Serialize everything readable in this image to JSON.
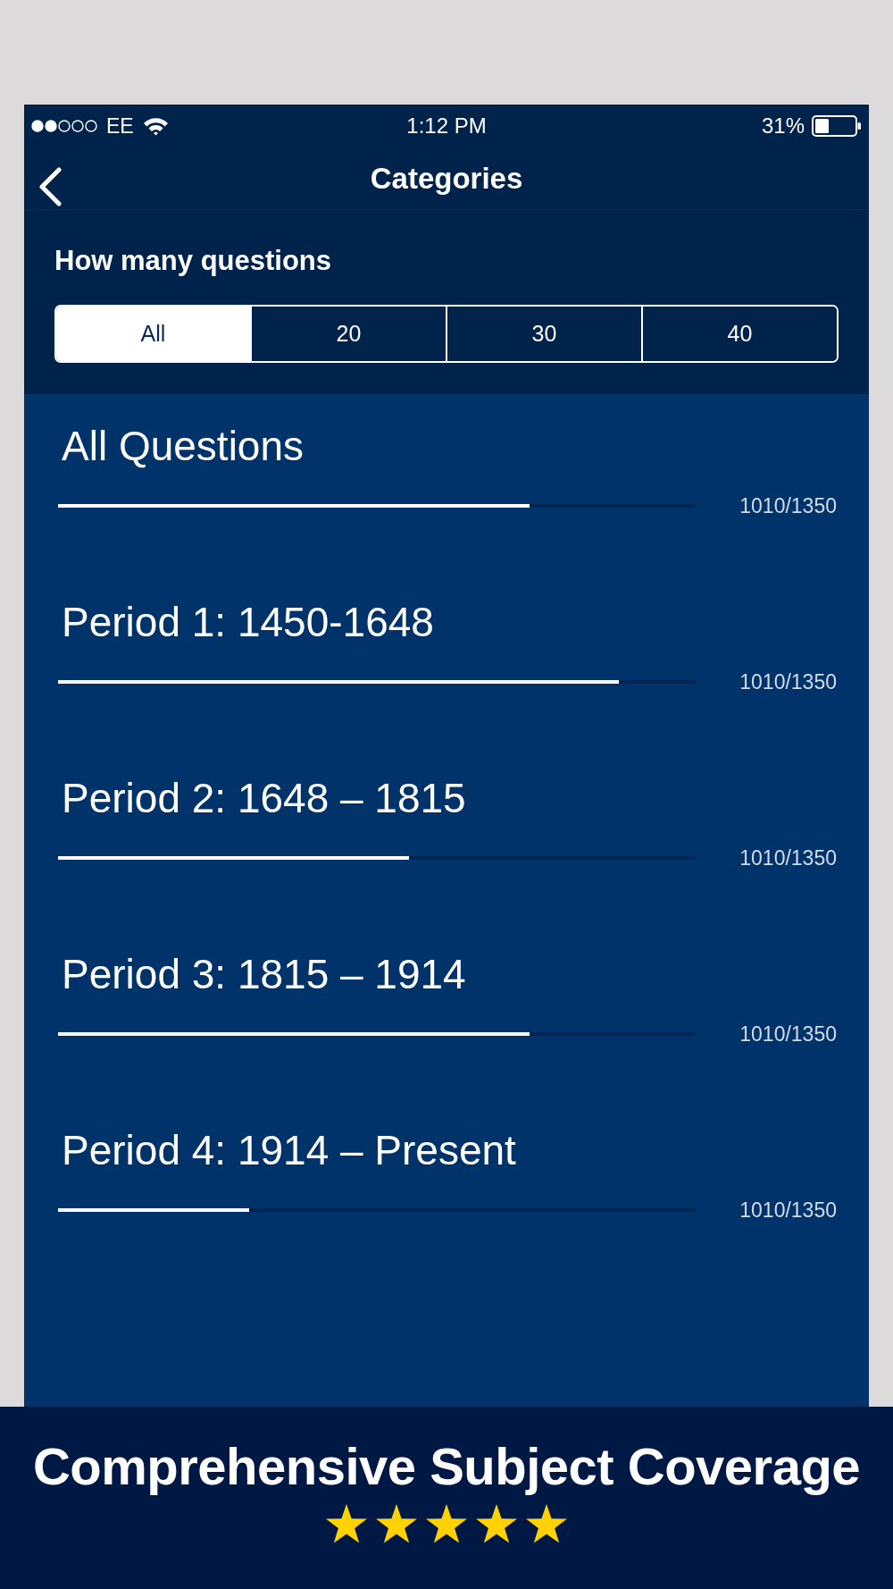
{
  "status_bar": {
    "carrier": "EE",
    "time": "1:12 PM",
    "battery": "31%"
  },
  "nav": {
    "title": "Categories"
  },
  "question_count": {
    "label": "How many questions",
    "options": [
      {
        "label": "All",
        "selected": true
      },
      {
        "label": "20",
        "selected": false
      },
      {
        "label": "30",
        "selected": false
      },
      {
        "label": "40",
        "selected": false
      }
    ]
  },
  "categories": [
    {
      "title": "All Questions",
      "level": 0.74,
      "reading": "1010/1350"
    },
    {
      "title": "Period 1: 1450-1648",
      "level": 0.88,
      "reading": "1010/1350"
    },
    {
      "title": "Period 2: 1648 – 1815",
      "level": 0.55,
      "reading": "1010/1350"
    },
    {
      "title": "Period 3: 1815 – 1914",
      "level": 0.74,
      "reading": "1010/1350"
    },
    {
      "title": "Period 4: 1914 – Present",
      "level": 0.3,
      "reading": "1010/1350"
    }
  ],
  "banner": {
    "title": "Comprehensive Subject Coverage",
    "stars": 5
  }
}
